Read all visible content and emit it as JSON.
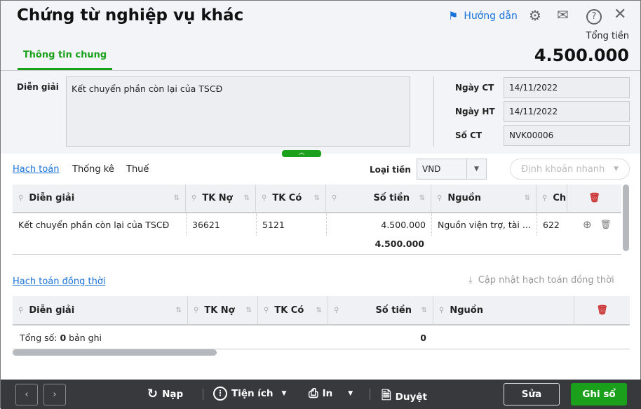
{
  "header": {
    "title": "Chứng từ nghiệp vụ khác",
    "guide": "Hướng dẫn",
    "total_label": "Tổng tiền",
    "total_value": "4.500.000",
    "tab": "Thông tin chung"
  },
  "form": {
    "desc_label": "Diễn giải",
    "desc_value": "Kết chuyển phần còn lại của TSCĐ",
    "date_ct_label": "Ngày CT",
    "date_ct": "14/11/2022",
    "date_ht_label": "Ngày HT",
    "date_ht": "14/11/2022",
    "so_ct_label": "Số CT",
    "so_ct": "NVK00006"
  },
  "tabs": [
    "Hạch toán",
    "Thống kê",
    "Thuế"
  ],
  "currency": {
    "label": "Loại tiền",
    "value": "VND"
  },
  "quick": "Định khoản nhanh",
  "grid1": {
    "headers": [
      "Diễn giải",
      "TK Nợ",
      "TK Có",
      "Số tiền",
      "Nguồn",
      "Chu"
    ],
    "rows": [
      [
        "Kết chuyển phần còn lại của TSCĐ",
        "36621",
        "5121",
        "4.500.000",
        "Nguồn viện trợ, tài ...",
        "622"
      ]
    ],
    "total": "4.500.000"
  },
  "grid2": {
    "title": "Hạch toán đồng thời",
    "update": "Cập nhật hạch toán đồng thời",
    "headers": [
      "Diễn giải",
      "TK Nợ",
      "TK Có",
      "Số tiền",
      "Nguồn"
    ],
    "count_prefix": "Tổng số: ",
    "count": "0",
    "count_suffix": " bản ghi",
    "total": "0"
  },
  "footer": {
    "reload": "Nạp",
    "utility": "Tiện ích",
    "print": "In",
    "approve": "Duyệt",
    "edit": "Sửa",
    "post": "Ghi sổ"
  },
  "colors": {
    "accent": "#1aa01a",
    "link": "#1a73d9",
    "footer": "#38393d"
  }
}
